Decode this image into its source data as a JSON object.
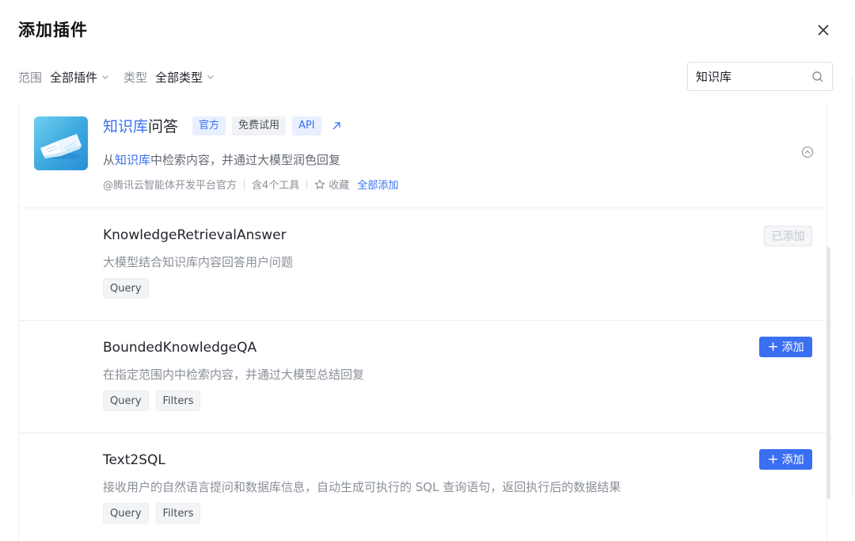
{
  "dialog": {
    "title": "添加插件"
  },
  "filters": {
    "scope_label": "范围",
    "scope_value": "全部插件",
    "type_label": "类型",
    "type_value": "全部类型"
  },
  "search": {
    "value": "知识库"
  },
  "plugin": {
    "name_highlight": "知识库",
    "name_rest": "问答",
    "tags": [
      "官方",
      "免费试用",
      "API"
    ],
    "desc_prefix": "从",
    "desc_highlight": "知识库",
    "desc_rest": "中检索内容，并通过大模型润色回复",
    "author": "@腾讯云智能体开发平台官方",
    "tool_count": "含4个工具",
    "favorite_label": "收藏",
    "add_all_label": "全部添加",
    "logo_colors": [
      "#6fd0ef",
      "#2c8fd6"
    ]
  },
  "tools": [
    {
      "name": "KnowledgeRetrievalAnswer",
      "desc": "大模型结合知识库内容回答用户问题",
      "params": [
        "Query"
      ],
      "action": "已添加",
      "added": true
    },
    {
      "name": "BoundedKnowledgeQA",
      "desc": "在指定范围内中检索内容，并通过大模型总结回复",
      "params": [
        "Query",
        "Filters"
      ],
      "action": "添加",
      "added": false
    },
    {
      "name": "Text2SQL",
      "desc": "接收用户的自然语言提问和数据库信息，自动生成可执行的 SQL 查询语句，返回执行后的数据结果",
      "params": [
        "Query",
        "Filters"
      ],
      "action": "添加",
      "added": false
    }
  ],
  "colors": {
    "accent": "#3a6ff2",
    "muted_text": "#8a8f99"
  }
}
